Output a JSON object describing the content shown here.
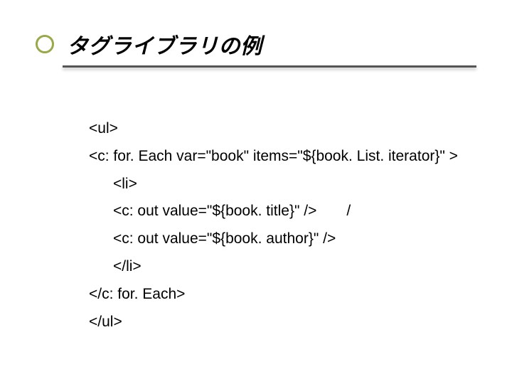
{
  "title": "タグライブラリの例",
  "code": {
    "l1": "<ul>",
    "l2": "<c: for. Each var=\"book\" items=\"${book. List. iterator}\" >",
    "l3": "<li>",
    "l4a": "<c: out value=\"${book. title}\" />",
    "l4b": "/",
    "l5": "<c: out value=\"${book. author}\" />",
    "l6": "</li>",
    "l7": "</c: for. Each>",
    "l8": "</ul>"
  }
}
